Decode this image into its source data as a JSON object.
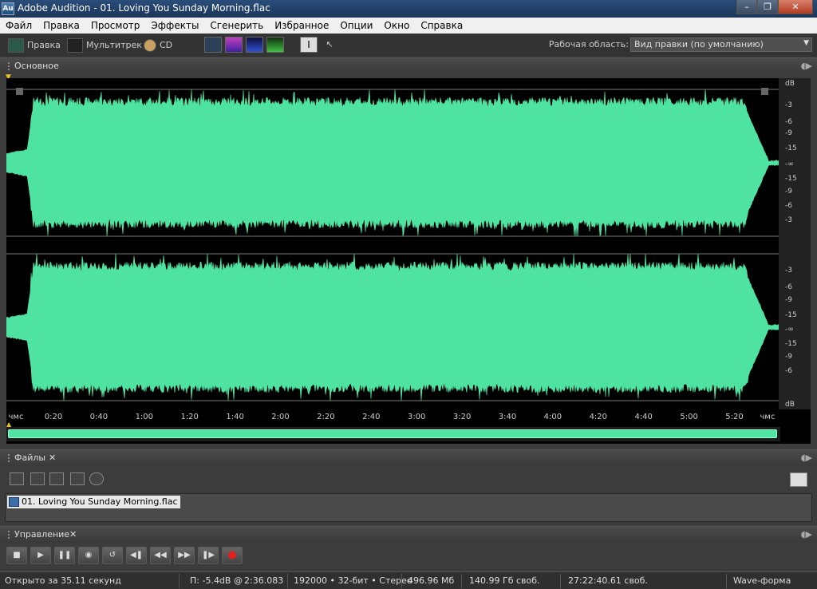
{
  "window": {
    "app_icon_text": "Au",
    "title": "Adobe Audition - 01. Loving You Sunday Morning.flac"
  },
  "menubar": [
    "Файл",
    "Правка",
    "Просмотр",
    "Эффекты",
    "Сгенерить",
    "Избранное",
    "Опции",
    "Окно",
    "Справка"
  ],
  "toolbar": {
    "edit_label": "Правка",
    "multitrack_label": "Мультитрек",
    "cd_label": "CD",
    "workspace_label": "Рабочая область:",
    "workspace_value": "Вид правки (по умолчанию)"
  },
  "editor_panel": {
    "tab_label": "Основное",
    "db_unit": "dB",
    "db_ticks_top": [
      "-3",
      "-6",
      "-9",
      "-15",
      "-∞",
      "-15",
      "-9",
      "-6",
      "-3"
    ],
    "db_ticks_bottom": [
      "-3",
      "-6",
      "-9",
      "-15",
      "-∞",
      "-15",
      "-9",
      "-6"
    ],
    "timeline_start": "чмс",
    "timeline_end": "чмс",
    "timeline_ticks": [
      "0:20",
      "0:40",
      "1:00",
      "1:20",
      "1:40",
      "2:00",
      "2:20",
      "2:40",
      "3:00",
      "3:20",
      "3:40",
      "4:00",
      "4:20",
      "4:40",
      "5:00",
      "5:20"
    ],
    "waveform_color": "#4fe3a1"
  },
  "files_panel": {
    "tab_label": "Файлы",
    "files": [
      "01. Loving You Sunday Morning.flac"
    ]
  },
  "transport_panel": {
    "tab_label": "Управление"
  },
  "statusbar": {
    "opened": "Открыто за 35.11 секунд",
    "peak": "П: -5.4dB @",
    "position": "2:36.083",
    "format": "192000 • 32-бит • Стерео",
    "file_size": "496.96 Мб",
    "disk_free": "140.99 Гб своб.",
    "time_free": "27:22:40.61 своб.",
    "view_mode": "Wave-форма"
  }
}
